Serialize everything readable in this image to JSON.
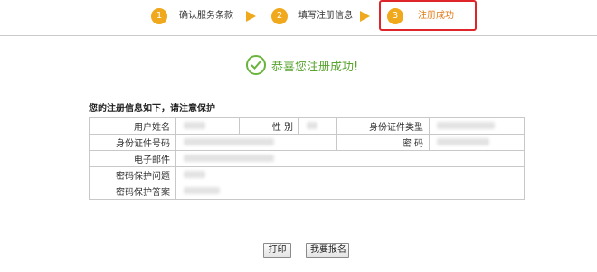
{
  "steps": [
    {
      "num": "1",
      "label": "确认服务条款"
    },
    {
      "num": "2",
      "label": "填写注册信息"
    },
    {
      "num": "3",
      "label": "注册成功"
    }
  ],
  "colors": {
    "step_circle": "#f0a81c",
    "highlight": "#e0252a",
    "success": "#5aa532"
  },
  "success_text": "恭喜您注册成功!",
  "info_title": "您的注册信息如下，请注意保护",
  "table": {
    "username_label": "用户姓名",
    "gender_label": "性 别",
    "id_type_label": "身份证件类型",
    "id_number_label": "身份证件号码",
    "password_label": "密 码",
    "email_label": "电子邮件",
    "question_label": "密码保护问题",
    "answer_label": "密码保护答案"
  },
  "buttons": {
    "print": "打印",
    "apply": "我要报名"
  }
}
